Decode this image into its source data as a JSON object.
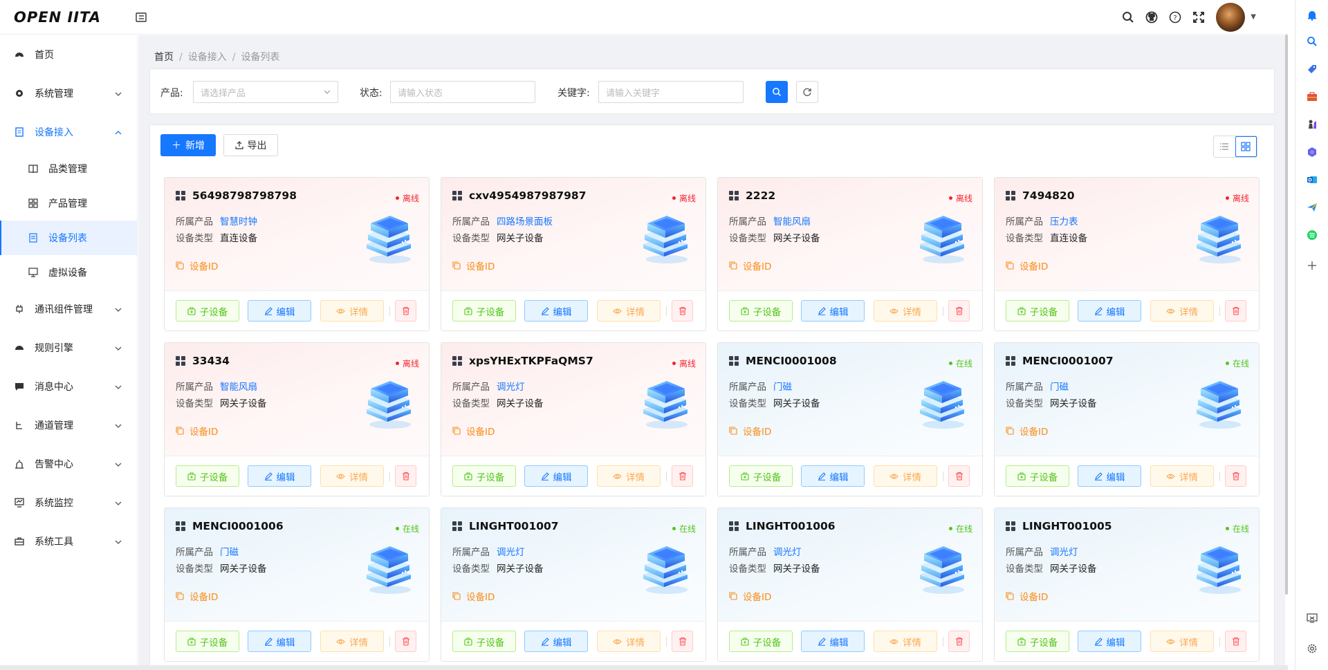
{
  "app": {
    "logo": "OPEN IITA"
  },
  "header": {
    "icons": [
      "search-icon",
      "github-icon",
      "help-icon",
      "fullscreen-icon"
    ]
  },
  "sidebar": {
    "items": [
      {
        "label": "首页",
        "icon": "dashboard-icon"
      },
      {
        "label": "系统管理",
        "icon": "gear-icon"
      },
      {
        "label": "设备接入",
        "icon": "device-icon"
      },
      {
        "label": "通讯组件管理",
        "icon": "plug-icon"
      },
      {
        "label": "规则引擎",
        "icon": "engine-icon"
      },
      {
        "label": "消息中心",
        "icon": "message-icon"
      },
      {
        "label": "通道管理",
        "icon": "channel-icon"
      },
      {
        "label": "告警中心",
        "icon": "alarm-icon"
      },
      {
        "label": "系统监控",
        "icon": "monitor-icon"
      },
      {
        "label": "系统工具",
        "icon": "toolbox-icon"
      }
    ],
    "sub_items": [
      {
        "label": "品类管理"
      },
      {
        "label": "产品管理"
      },
      {
        "label": "设备列表"
      },
      {
        "label": "虚拟设备"
      }
    ]
  },
  "breadcrumb": {
    "home": "首页",
    "level1": "设备接入",
    "level2": "设备列表"
  },
  "search": {
    "product_label": "产品:",
    "product_placeholder": "请选择产品",
    "status_label": "状态:",
    "status_placeholder": "请输入状态",
    "keyword_label": "关键字:",
    "keyword_placeholder": "请输入关键字"
  },
  "toolbar": {
    "add_label": "新增",
    "export_label": "导出"
  },
  "labels": {
    "product": "所属产品",
    "type": "设备类型",
    "device_id": "设备ID",
    "sub_device": "子设备",
    "edit": "编辑",
    "detail": "详情"
  },
  "devices": [
    {
      "name": "56498798798798",
      "status": "离线",
      "product": "智慧时钟",
      "type": "直连设备"
    },
    {
      "name": "cxv4954987987987",
      "status": "离线",
      "product": "四路场景面板",
      "type": "网关子设备"
    },
    {
      "name": "2222",
      "status": "离线",
      "product": "智能风扇",
      "type": "网关子设备"
    },
    {
      "name": "7494820",
      "status": "离线",
      "product": "压力表",
      "type": "直连设备"
    },
    {
      "name": "33434",
      "status": "离线",
      "product": "智能风扇",
      "type": "网关子设备"
    },
    {
      "name": "xpsYHExTKPFaQMS7",
      "status": "离线",
      "product": "调光灯",
      "type": "网关子设备"
    },
    {
      "name": "MENCI0001008",
      "status": "在线",
      "product": "门磁",
      "type": "网关子设备"
    },
    {
      "name": "MENCI0001007",
      "status": "在线",
      "product": "门磁",
      "type": "网关子设备"
    },
    {
      "name": "MENCI0001006",
      "status": "在线",
      "product": "门磁",
      "type": "网关子设备"
    },
    {
      "name": "LINGHT001007",
      "status": "在线",
      "product": "调光灯",
      "type": "网关子设备"
    },
    {
      "name": "LINGHT001006",
      "status": "在线",
      "product": "调光灯",
      "type": "网关子设备"
    },
    {
      "name": "LINGHT001005",
      "status": "在线",
      "product": "调光灯",
      "type": "网关子设备"
    }
  ],
  "colors": {
    "primary": "#1677ff",
    "offline": "#f5222d",
    "online": "#52c41a",
    "warning": "#fa8c16"
  }
}
